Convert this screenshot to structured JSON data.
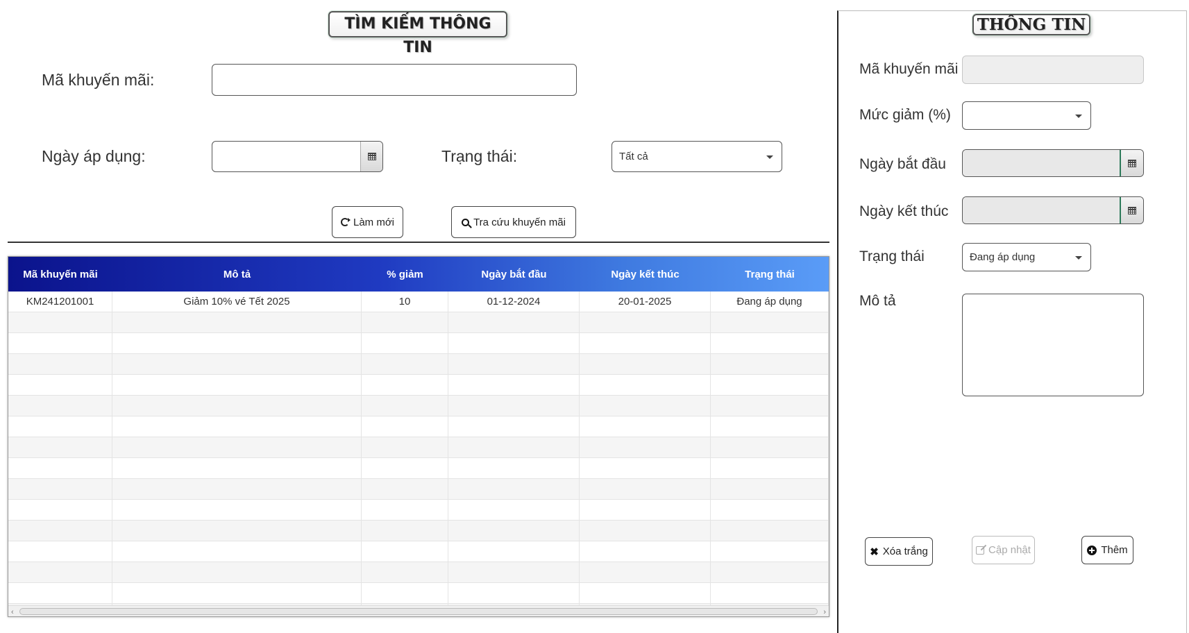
{
  "search": {
    "title": "TÌM KIẾM THÔNG TIN",
    "code_label": "Mã khuyến mãi:",
    "code_value": "",
    "date_label": "Ngày áp dụng:",
    "date_value": "",
    "status_label": "Trạng thái:",
    "status_selected": "Tất cả",
    "refresh_label": "Làm mới",
    "search_label": "Tra cứu khuyến mãi"
  },
  "table": {
    "columns": [
      "Mã khuyến mãi",
      "Mô tả",
      "% giảm",
      "Ngày bắt đầu",
      "Ngày kết thúc",
      "Trạng thái"
    ],
    "rows": [
      [
        "KM241201001",
        "Giảm 10% vé Tết 2025",
        "10",
        "01-12-2024",
        "20-01-2025",
        "Đang áp dụng"
      ]
    ],
    "empty_row_count": 15
  },
  "info": {
    "title": "THÔNG TIN",
    "code_label": "Mã khuyến mãi",
    "code_value": "",
    "discount_label": "Mức giảm (%)",
    "discount_selected": "",
    "start_label": "Ngày bắt đầu",
    "start_value": "",
    "end_label": "Ngày kết thúc",
    "end_value": "",
    "status_label": "Trạng thái",
    "status_selected": "Đang áp dụng",
    "desc_label": "Mô tả",
    "desc_value": "",
    "clear_label": "Xóa trắng",
    "update_label": "Cập nhật",
    "add_label": "Thêm"
  },
  "colors": {
    "header_start": "#0b138c",
    "header_end": "#5a9cf7"
  }
}
